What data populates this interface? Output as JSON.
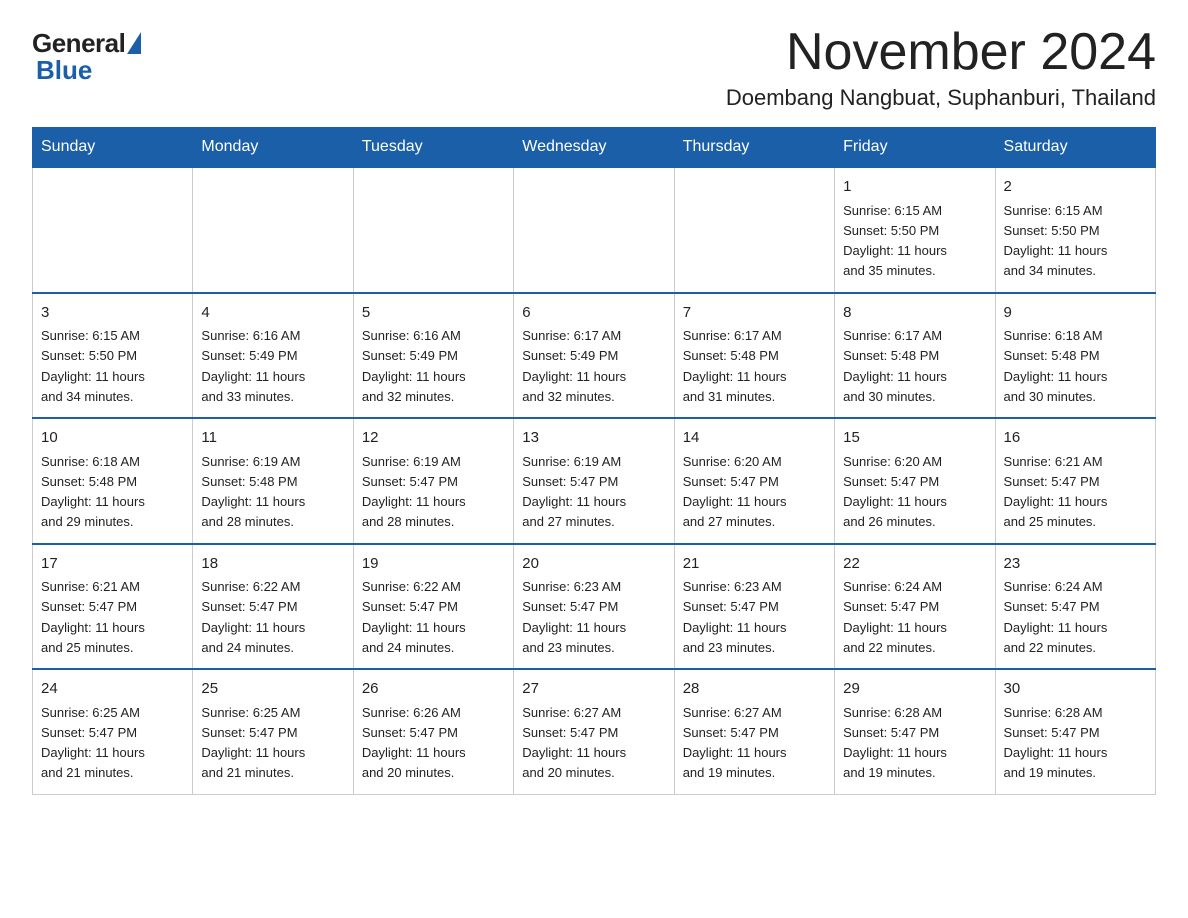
{
  "logo": {
    "general": "General",
    "blue": "Blue"
  },
  "header": {
    "month": "November 2024",
    "location": "Doembang Nangbuat, Suphanburi, Thailand"
  },
  "days_of_week": [
    "Sunday",
    "Monday",
    "Tuesday",
    "Wednesday",
    "Thursday",
    "Friday",
    "Saturday"
  ],
  "weeks": [
    [
      {
        "day": "",
        "info": ""
      },
      {
        "day": "",
        "info": ""
      },
      {
        "day": "",
        "info": ""
      },
      {
        "day": "",
        "info": ""
      },
      {
        "day": "",
        "info": ""
      },
      {
        "day": "1",
        "info": "Sunrise: 6:15 AM\nSunset: 5:50 PM\nDaylight: 11 hours\nand 35 minutes."
      },
      {
        "day": "2",
        "info": "Sunrise: 6:15 AM\nSunset: 5:50 PM\nDaylight: 11 hours\nand 34 minutes."
      }
    ],
    [
      {
        "day": "3",
        "info": "Sunrise: 6:15 AM\nSunset: 5:50 PM\nDaylight: 11 hours\nand 34 minutes."
      },
      {
        "day": "4",
        "info": "Sunrise: 6:16 AM\nSunset: 5:49 PM\nDaylight: 11 hours\nand 33 minutes."
      },
      {
        "day": "5",
        "info": "Sunrise: 6:16 AM\nSunset: 5:49 PM\nDaylight: 11 hours\nand 32 minutes."
      },
      {
        "day": "6",
        "info": "Sunrise: 6:17 AM\nSunset: 5:49 PM\nDaylight: 11 hours\nand 32 minutes."
      },
      {
        "day": "7",
        "info": "Sunrise: 6:17 AM\nSunset: 5:48 PM\nDaylight: 11 hours\nand 31 minutes."
      },
      {
        "day": "8",
        "info": "Sunrise: 6:17 AM\nSunset: 5:48 PM\nDaylight: 11 hours\nand 30 minutes."
      },
      {
        "day": "9",
        "info": "Sunrise: 6:18 AM\nSunset: 5:48 PM\nDaylight: 11 hours\nand 30 minutes."
      }
    ],
    [
      {
        "day": "10",
        "info": "Sunrise: 6:18 AM\nSunset: 5:48 PM\nDaylight: 11 hours\nand 29 minutes."
      },
      {
        "day": "11",
        "info": "Sunrise: 6:19 AM\nSunset: 5:48 PM\nDaylight: 11 hours\nand 28 minutes."
      },
      {
        "day": "12",
        "info": "Sunrise: 6:19 AM\nSunset: 5:47 PM\nDaylight: 11 hours\nand 28 minutes."
      },
      {
        "day": "13",
        "info": "Sunrise: 6:19 AM\nSunset: 5:47 PM\nDaylight: 11 hours\nand 27 minutes."
      },
      {
        "day": "14",
        "info": "Sunrise: 6:20 AM\nSunset: 5:47 PM\nDaylight: 11 hours\nand 27 minutes."
      },
      {
        "day": "15",
        "info": "Sunrise: 6:20 AM\nSunset: 5:47 PM\nDaylight: 11 hours\nand 26 minutes."
      },
      {
        "day": "16",
        "info": "Sunrise: 6:21 AM\nSunset: 5:47 PM\nDaylight: 11 hours\nand 25 minutes."
      }
    ],
    [
      {
        "day": "17",
        "info": "Sunrise: 6:21 AM\nSunset: 5:47 PM\nDaylight: 11 hours\nand 25 minutes."
      },
      {
        "day": "18",
        "info": "Sunrise: 6:22 AM\nSunset: 5:47 PM\nDaylight: 11 hours\nand 24 minutes."
      },
      {
        "day": "19",
        "info": "Sunrise: 6:22 AM\nSunset: 5:47 PM\nDaylight: 11 hours\nand 24 minutes."
      },
      {
        "day": "20",
        "info": "Sunrise: 6:23 AM\nSunset: 5:47 PM\nDaylight: 11 hours\nand 23 minutes."
      },
      {
        "day": "21",
        "info": "Sunrise: 6:23 AM\nSunset: 5:47 PM\nDaylight: 11 hours\nand 23 minutes."
      },
      {
        "day": "22",
        "info": "Sunrise: 6:24 AM\nSunset: 5:47 PM\nDaylight: 11 hours\nand 22 minutes."
      },
      {
        "day": "23",
        "info": "Sunrise: 6:24 AM\nSunset: 5:47 PM\nDaylight: 11 hours\nand 22 minutes."
      }
    ],
    [
      {
        "day": "24",
        "info": "Sunrise: 6:25 AM\nSunset: 5:47 PM\nDaylight: 11 hours\nand 21 minutes."
      },
      {
        "day": "25",
        "info": "Sunrise: 6:25 AM\nSunset: 5:47 PM\nDaylight: 11 hours\nand 21 minutes."
      },
      {
        "day": "26",
        "info": "Sunrise: 6:26 AM\nSunset: 5:47 PM\nDaylight: 11 hours\nand 20 minutes."
      },
      {
        "day": "27",
        "info": "Sunrise: 6:27 AM\nSunset: 5:47 PM\nDaylight: 11 hours\nand 20 minutes."
      },
      {
        "day": "28",
        "info": "Sunrise: 6:27 AM\nSunset: 5:47 PM\nDaylight: 11 hours\nand 19 minutes."
      },
      {
        "day": "29",
        "info": "Sunrise: 6:28 AM\nSunset: 5:47 PM\nDaylight: 11 hours\nand 19 minutes."
      },
      {
        "day": "30",
        "info": "Sunrise: 6:28 AM\nSunset: 5:47 PM\nDaylight: 11 hours\nand 19 minutes."
      }
    ]
  ]
}
